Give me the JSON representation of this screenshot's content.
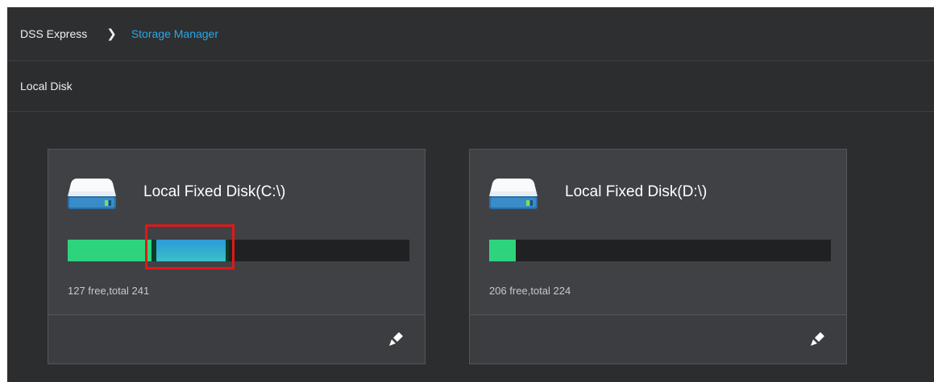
{
  "breadcrumb": {
    "root": "DSS Express",
    "current": "Storage Manager"
  },
  "section_title": "Local Disk",
  "disks": [
    {
      "title": "Local Fixed Disk(C:\\)",
      "free_text": "127 free,total 241",
      "used_fraction": 0.473,
      "icon": "hard-drive-icon",
      "action_icon": "edit-icon"
    },
    {
      "title": "Local Fixed Disk(D:\\)",
      "free_text": "206 free,total 224",
      "used_fraction": 0.08,
      "icon": "hard-drive-icon",
      "action_icon": "edit-icon"
    }
  ],
  "colors": {
    "accent": "#27a8e8",
    "used_bar": "#2ed37d",
    "second_bar": "#2d9ad8",
    "highlight": "#e01818"
  }
}
